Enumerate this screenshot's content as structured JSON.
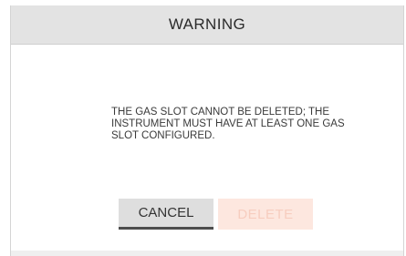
{
  "dialog": {
    "title": "WARNING",
    "message": "THE GAS SLOT CANNOT BE DELETED; THE INSTRUMENT MUST HAVE AT LEAST ONE GAS SLOT CONFIGURED.",
    "buttons": {
      "cancel_label": "CANCEL",
      "delete_label": "DELETE"
    }
  },
  "colors": {
    "header_bg": "#e3e3e3",
    "cancel_bg": "#dedede",
    "delete_bg_disabled": "#fde7df",
    "delete_text_disabled": "#f7cdbf"
  }
}
